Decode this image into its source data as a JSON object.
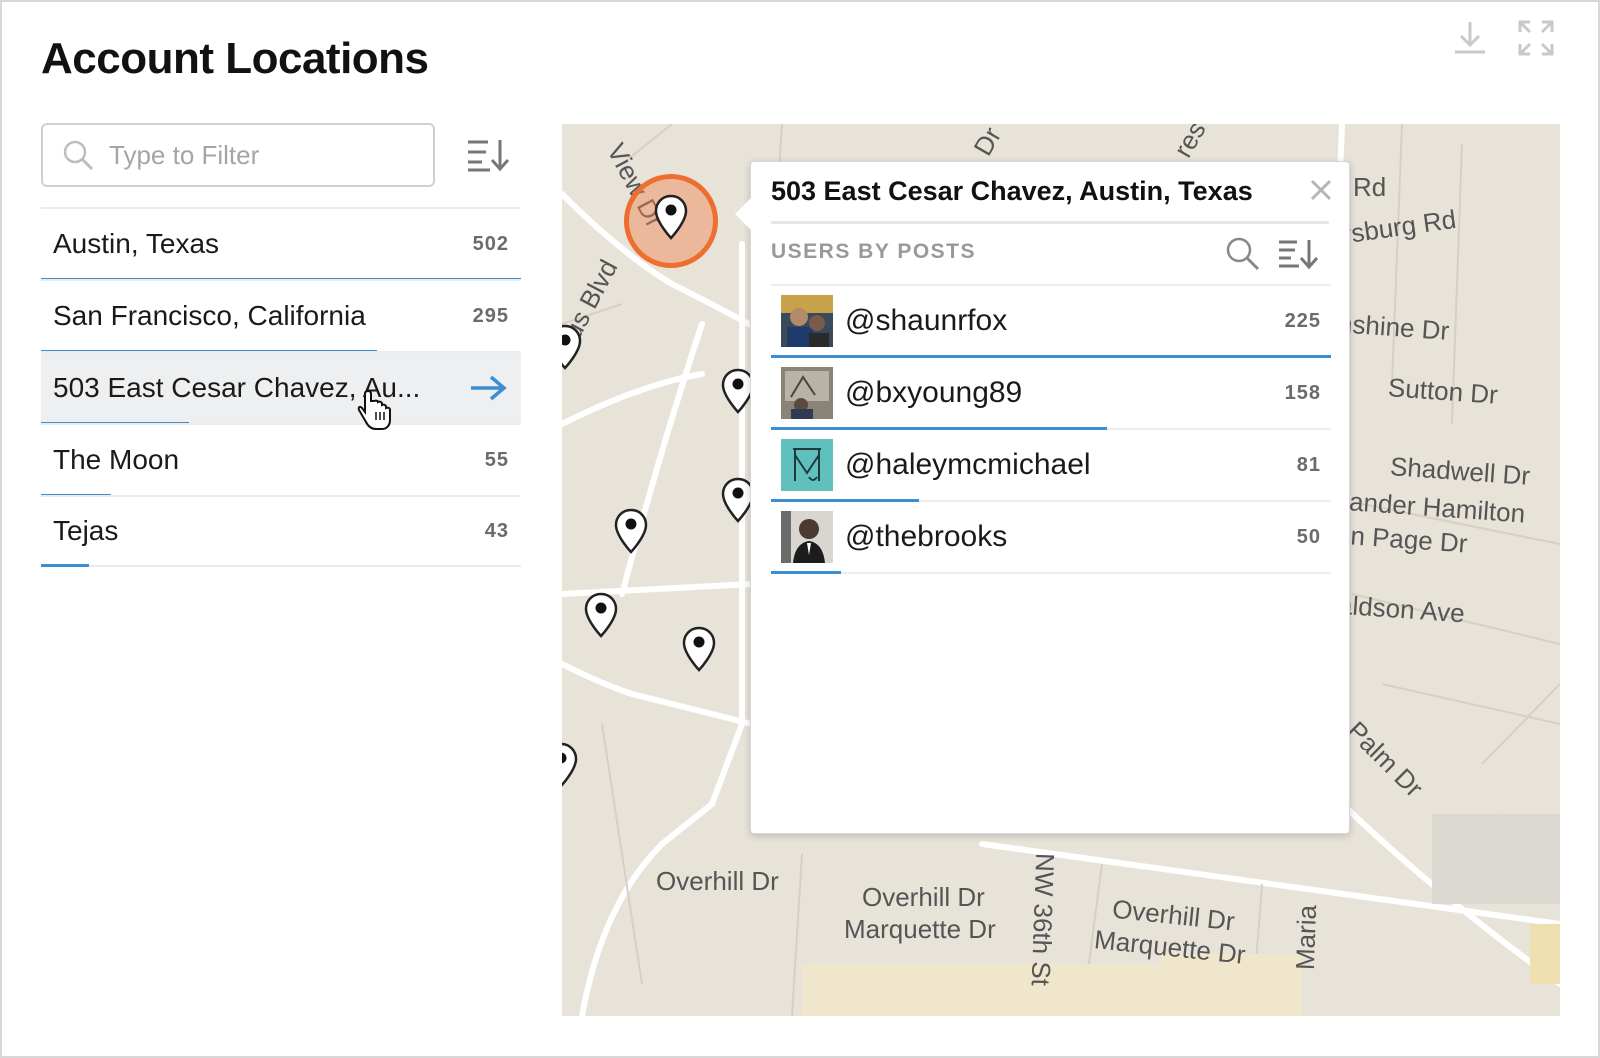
{
  "page": {
    "title": "Account Locations"
  },
  "toolbar": {
    "download_icon": "download-icon",
    "expand_icon": "expand-icon"
  },
  "filter": {
    "placeholder": "Type to Filter",
    "value": ""
  },
  "locations": [
    {
      "name": "Austin, Texas",
      "count": "502",
      "share": 1.0
    },
    {
      "name": "San Francisco, California",
      "count": "295",
      "share": 0.7
    },
    {
      "name": "503 East Cesar Chavez, Au...",
      "count": "",
      "share": 0.31,
      "active": true
    },
    {
      "name": "The Moon",
      "count": "55",
      "share": 0.145
    },
    {
      "name": "Tejas",
      "count": "43",
      "share": 0.1
    }
  ],
  "map": {
    "streets": [
      "View Dr",
      "us Blvd",
      "l Rd",
      "ysburg Rd",
      "nshine Dr",
      "Sutton Dr",
      "Shadwell Dr",
      "xander Hamilton",
      "hn Page Dr",
      "aldson Ave",
      "Palm Dr",
      "Overhill Dr",
      "Overhill Dr",
      "Marquette Dr",
      "NW 36th St",
      "Overhill Dr",
      "Marquette Dr",
      "Maria",
      "Dr",
      "res"
    ]
  },
  "popup": {
    "title": "503 East Cesar Chavez, Austin, Texas",
    "section_label": "USERS BY POSTS",
    "users": [
      {
        "handle": "@shaunrfox",
        "count": "225",
        "share": 1.0
      },
      {
        "handle": "@bxyoung89",
        "count": "158",
        "share": 0.6
      },
      {
        "handle": "@haleymcmichael",
        "count": "81",
        "share": 0.265
      },
      {
        "handle": "@thebrooks",
        "count": "50",
        "share": 0.125
      }
    ]
  },
  "colors": {
    "accent": "#3d8ed0",
    "selected_ring": "#ee6e2f",
    "map_bg": "#e8e3d9"
  }
}
